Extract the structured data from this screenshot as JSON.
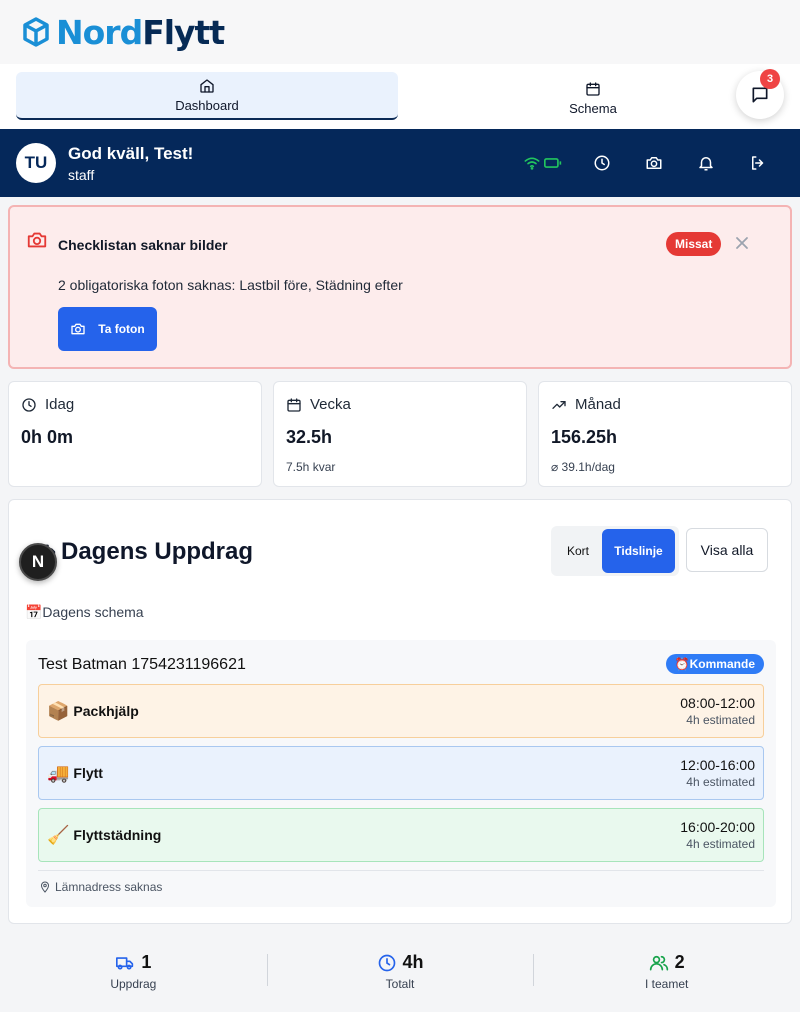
{
  "brand": {
    "part1": "Nord",
    "part2": "Flytt"
  },
  "nav": {
    "dashboard_label": "Dashboard",
    "schema_label": "Schema",
    "chat_badge": "3"
  },
  "user": {
    "initials": "TU",
    "greeting": "God kväll, Test!",
    "role": "staff"
  },
  "alert": {
    "title": "Checklistan saknar bilder",
    "badge": "Missat",
    "message": "2 obligatoriska foton saknas: Lastbil före, Städning efter",
    "button_label": "Ta foton"
  },
  "stats": [
    {
      "label": "Idag",
      "value": "0h 0m",
      "sub": ""
    },
    {
      "label": "Vecka",
      "value": "32.5h",
      "sub": "7.5h kvar"
    },
    {
      "label": "Månad",
      "value": "156.25h",
      "sub": "⌀ 39.1h/dag"
    }
  ],
  "assignments": {
    "title": "Dagens Uppdrag",
    "view_toggle": {
      "card": "Kort",
      "timeline": "Tidslinje",
      "active": "Tidslinje"
    },
    "show_all": "Visa alla",
    "schedule_label": "📅Dagens schema",
    "job": {
      "title": "Test Batman 1754231196621",
      "status": "⏰Kommande",
      "tasks": [
        {
          "emoji": "📦",
          "name": "Packhjälp",
          "time": "08:00-12:00",
          "estimate": "4h estimated"
        },
        {
          "emoji": "🚚",
          "name": "Flytt",
          "time": "12:00-16:00",
          "estimate": "4h estimated"
        },
        {
          "emoji": "🧹",
          "name": "Flyttstädning",
          "time": "16:00-20:00",
          "estimate": "4h estimated"
        }
      ],
      "address_note": "Lämnadress saknas"
    }
  },
  "dev_badge": "N",
  "summary": [
    {
      "value": "1",
      "label": "Uppdrag"
    },
    {
      "value": "4h",
      "label": "Totalt"
    },
    {
      "value": "2",
      "label": "I teamet"
    }
  ],
  "colors": {
    "navy": "#05285a",
    "primary": "#2563eb",
    "danger": "#e53935",
    "logo_blue": "#1a8fd6"
  }
}
